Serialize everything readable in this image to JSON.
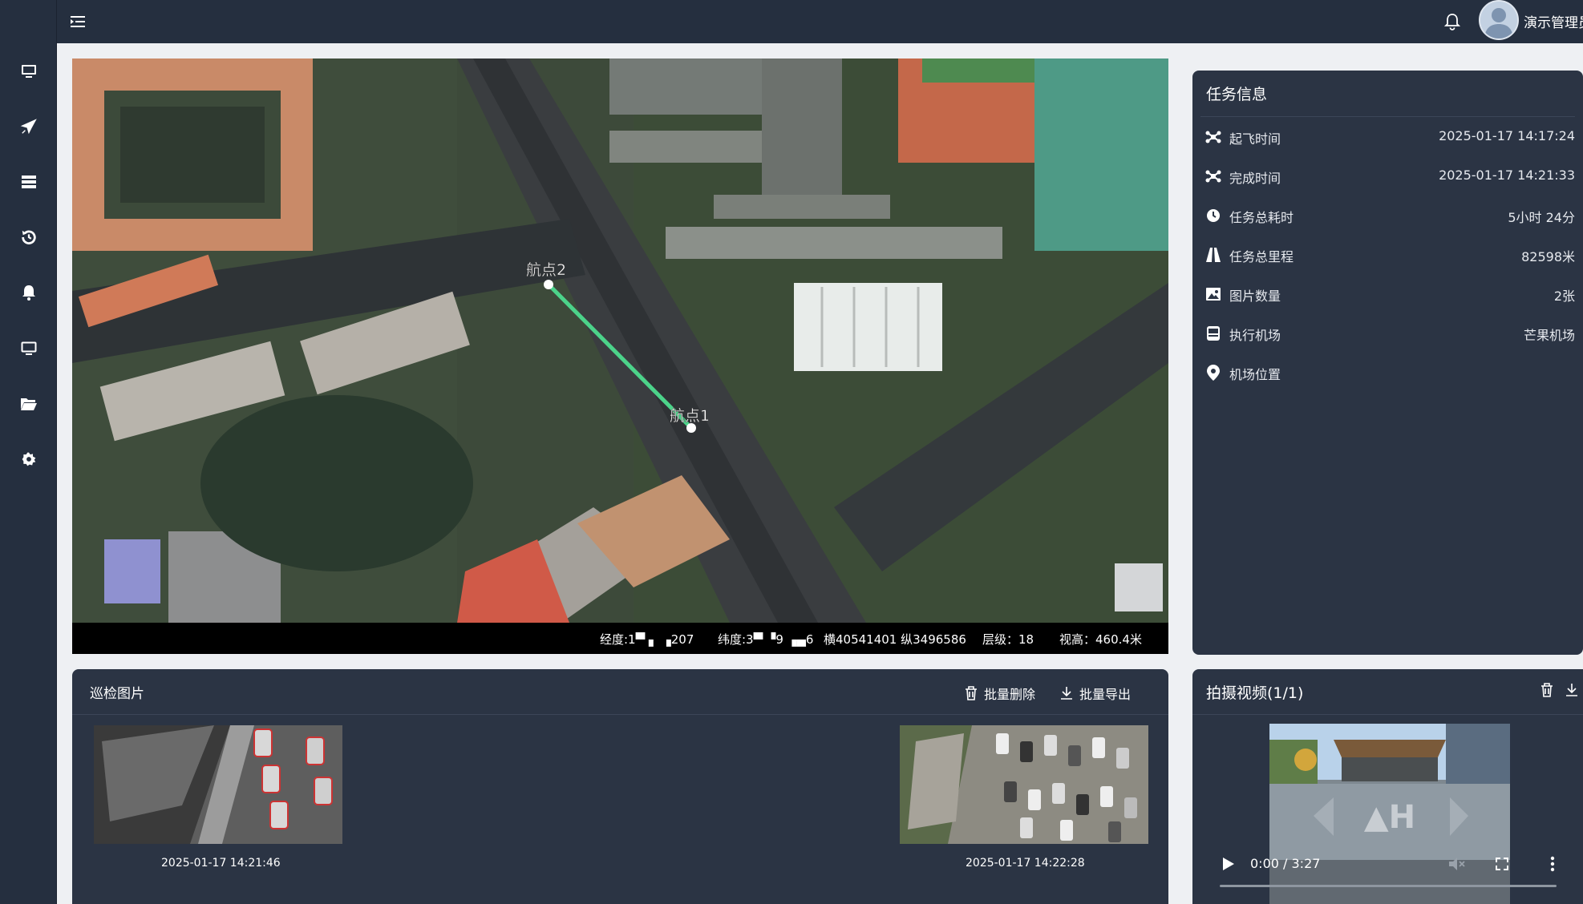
{
  "header": {
    "username": "演示管理员"
  },
  "sidebar": {
    "items": [
      {
        "icon": "monitor-icon"
      },
      {
        "icon": "plane-icon"
      },
      {
        "icon": "server-icon"
      },
      {
        "icon": "history-icon"
      },
      {
        "icon": "bell-icon"
      },
      {
        "icon": "screen-icon"
      },
      {
        "icon": "folder-open-icon"
      },
      {
        "icon": "gear-icon"
      }
    ]
  },
  "map": {
    "waypoints": [
      {
        "label": "航点2"
      },
      {
        "label": "航点1"
      }
    ],
    "route_color": "#4cd38a",
    "status": {
      "lng": "经度:1▀ ▖ ▗207",
      "lat": "纬度:3▀ ▝9 ▗▄6",
      "proj": "横40541401 纵3496586",
      "zoom": "层级：18",
      "altitude": "视高：460.4米"
    }
  },
  "task": {
    "title": "任务信息",
    "rows": [
      {
        "icon": "drone-icon",
        "label": "起飞时间",
        "value": "2025-01-17 14:17:24"
      },
      {
        "icon": "drone-icon",
        "label": "完成时间",
        "value": "2025-01-17 14:21:33"
      },
      {
        "icon": "clock-icon",
        "label": "任务总耗时",
        "value": "5小时 24分"
      },
      {
        "icon": "road-icon",
        "label": "任务总里程",
        "value": "82598米"
      },
      {
        "icon": "image-icon",
        "label": "图片数量",
        "value": "2张"
      },
      {
        "icon": "dock-icon",
        "label": "执行机场",
        "value": "芒果机场"
      },
      {
        "icon": "location-pin-icon",
        "label": "机场位置",
        "value": ""
      }
    ]
  },
  "photos": {
    "title": "巡检图片",
    "batch_delete": "批量删除",
    "batch_export": "批量导出",
    "items": [
      {
        "time": "2025-01-17 14:21:46"
      },
      {
        "time": "2025-01-17 14:22:28"
      }
    ]
  },
  "video": {
    "title": "拍摄视频(1/1)",
    "time": "0:00 / 3:27",
    "overlay": "▲H"
  }
}
